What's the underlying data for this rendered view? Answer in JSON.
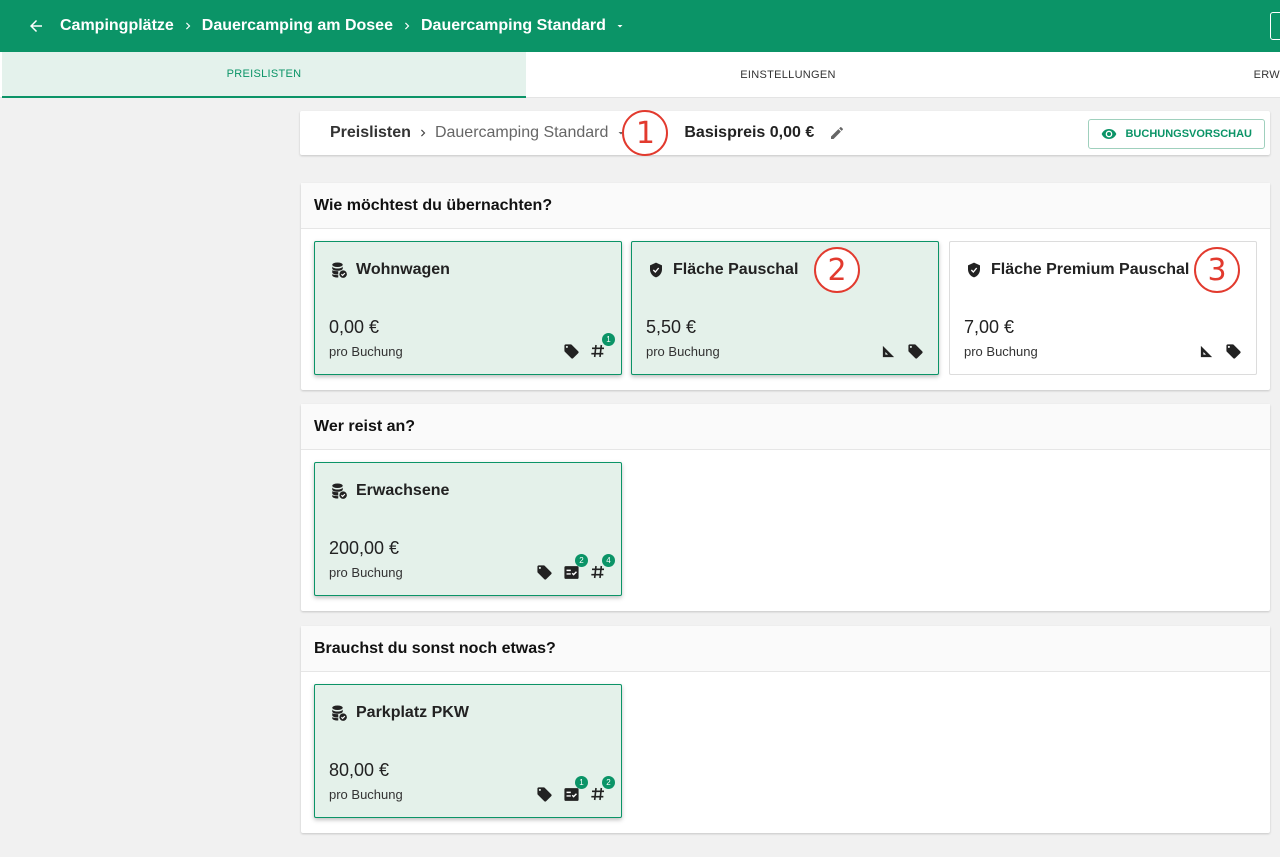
{
  "topbar": {
    "breadcrumbs": [
      "Campingplätze",
      "Dauercamping am Dosee",
      "Dauercamping Standard"
    ]
  },
  "tabs": [
    "PREISLISTEN",
    "EINSTELLUNGEN",
    "ERW"
  ],
  "header": {
    "crumb_root": "Preislisten",
    "crumb_current": "Dauercamping Standard",
    "annotation": "1",
    "base_price": "Basispreis 0,00 €",
    "preview_label": "BUCHUNGSVORSCHAU"
  },
  "sections": [
    {
      "title": "Wie möchtest du übernachten?",
      "cards": [
        {
          "title": "Wohnwagen",
          "icon": "coins-check-icon",
          "price": "0,00 €",
          "unit": "pro Buchung",
          "active": true,
          "badges": {
            "hash": "1"
          }
        },
        {
          "title": "Fläche Pauschal",
          "icon": "shield-icon",
          "price": "5,50 €",
          "unit": "pro Buchung",
          "active": true,
          "annotation": "2"
        },
        {
          "title": "Fläche Premium Pauschal",
          "icon": "shield-icon",
          "price": "7,00 €",
          "unit": "pro Buchung",
          "active": false,
          "annotation": "3"
        }
      ]
    },
    {
      "title": "Wer reist an?",
      "cards": [
        {
          "title": "Erwachsene",
          "icon": "coins-check-icon",
          "price": "200,00 €",
          "unit": "pro Buchung",
          "active": true,
          "badges": {
            "check": "2",
            "hash": "4"
          }
        }
      ]
    },
    {
      "title": "Brauchst du sonst noch etwas?",
      "cards": [
        {
          "title": "Parkplatz PKW",
          "icon": "coins-check-icon",
          "price": "80,00 €",
          "unit": "pro Buchung",
          "active": true,
          "badges": {
            "check": "1",
            "hash": "2"
          }
        }
      ]
    }
  ],
  "colors": {
    "brand": "#0b9467",
    "card_active_bg": "#e4f1ea",
    "annotation": "#e23a2e"
  }
}
